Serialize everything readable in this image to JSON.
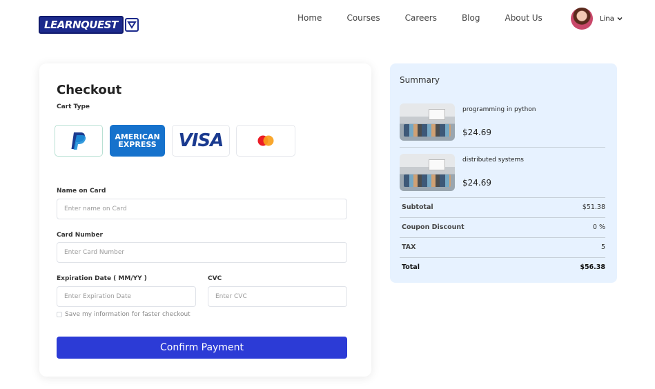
{
  "header": {
    "logo_text": "LEARNQUEST",
    "nav": [
      "Home",
      "Courses",
      "Careers",
      "Blog",
      "About Us"
    ],
    "user_name": "Lina"
  },
  "checkout": {
    "title": "Checkout",
    "cart_type_label": "Cart Type",
    "payment_methods": [
      {
        "name": "PayPal",
        "selected": true
      },
      {
        "name": "American Express",
        "line1": "AMERICAN",
        "line2": "EXPRESS"
      },
      {
        "name": "Visa",
        "text": "VISA"
      },
      {
        "name": "Mastercard"
      }
    ],
    "name_label": "Name on Card",
    "name_placeholder": "Enter name on Card",
    "card_label": "Card Number",
    "card_placeholder": "Enter Card Number",
    "exp_label": "Expiration Date ( MM/YY )",
    "exp_placeholder": "Enter Expiration Date",
    "cvc_label": "CVC",
    "cvc_placeholder": "Enter CVC",
    "save_label": "Save my information for faster checkout",
    "confirm_label": "Confirm Payment"
  },
  "summary": {
    "title": "Summary",
    "items": [
      {
        "name": "programming in python",
        "price": "$24.69"
      },
      {
        "name": "distributed systems",
        "price": "$24.69"
      }
    ],
    "rows": [
      {
        "label": "Subtotal",
        "value": "$51.38"
      },
      {
        "label": "Coupon Discount",
        "value": "0 %"
      },
      {
        "label": "TAX",
        "value": "5"
      },
      {
        "label": "Total",
        "value": "$56.38"
      }
    ]
  },
  "colors": {
    "primary_button": "#2c3bd6",
    "summary_bg": "#e7f2ff",
    "logo": "#1c2a8c"
  }
}
